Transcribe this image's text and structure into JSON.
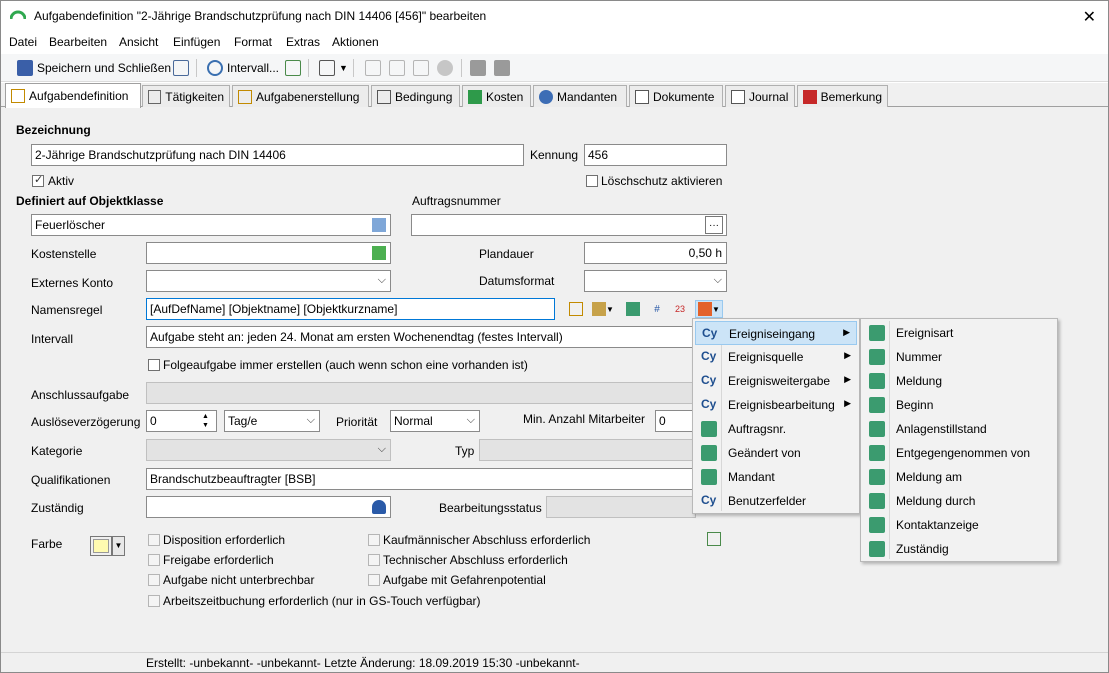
{
  "window": {
    "title": "Aufgabendefinition \"2-Jährige Brandschutzprüfung nach DIN 14406 [456]\" bearbeiten"
  },
  "menubar": {
    "items": [
      "Datei",
      "Bearbeiten",
      "Ansicht",
      "Einfügen",
      "Format",
      "Extras",
      "Aktionen"
    ]
  },
  "toolbar": {
    "save_close": "Speichern und Schließen",
    "interval": "Intervall..."
  },
  "tabs": [
    {
      "label": "Aufgabendefinition",
      "icon": "task-check-icon",
      "active": true
    },
    {
      "label": "Tätigkeiten",
      "icon": "wrench-icon",
      "active": false
    },
    {
      "label": "Aufgabenerstellung",
      "icon": "task-create-icon",
      "active": false
    },
    {
      "label": "Bedingung",
      "icon": "condition-icon",
      "active": false
    },
    {
      "label": "Kosten",
      "icon": "money-icon",
      "active": false
    },
    {
      "label": "Mandanten",
      "icon": "people-icon",
      "active": false
    },
    {
      "label": "Dokumente",
      "icon": "document-icon",
      "active": false
    },
    {
      "label": "Journal",
      "icon": "journal-icon",
      "active": false
    },
    {
      "label": "Bemerkung",
      "icon": "note-icon",
      "active": false
    }
  ],
  "form": {
    "bezeichnung_label": "Bezeichnung",
    "bezeichnung_value": "2-Jährige Brandschutzprüfung nach DIN 14406",
    "kennung_label": "Kennung",
    "kennung_value": "456",
    "aktiv_label": "Aktiv",
    "aktiv_checked": true,
    "loeschschutz_label": "Löschschutz aktivieren",
    "objektklasse_label": "Definiert auf Objektklasse",
    "objektklasse_value": "Feuerlöscher",
    "auftragsnummer_label": "Auftragsnummer",
    "auftragsnummer_value": "",
    "auftragsnummer_button": "···",
    "kostenstelle_label": "Kostenstelle",
    "plandauer_label": "Plandauer",
    "plandauer_value": "0,50 h",
    "externes_konto_label": "Externes Konto",
    "datumsformat_label": "Datumsformat",
    "namensregel_label": "Namensregel",
    "namensregel_value": "[AufDefName] [Objektname] [Objektkurzname]",
    "intervall_label": "Intervall",
    "intervall_value": "Aufgabe steht an: jeden 24. Monat am ersten Wochenendtag  (festes Intervall)",
    "folgeaufgabe_label": "Folgeaufgabe immer erstellen (auch wenn schon eine vorhanden ist)",
    "anschluss_label": "Anschlussaufgabe",
    "ausloese_label": "Auslöseverzögerung",
    "ausloese_value": "0",
    "ausloese_unit": "Tag/e",
    "prioritaet_label": "Priorität",
    "prioritaet_value": "Normal",
    "mitarbeiter_label": "Min. Anzahl Mitarbeiter",
    "mitarbeiter_value": "0",
    "kategorie_label": "Kategorie",
    "typ_label": "Typ",
    "qualifikationen_label": "Qualifikationen",
    "qualifikationen_value": "Brandschutzbeauftragter [BSB]",
    "zustaendig_label": "Zuständig",
    "bearbeitungsstatus_label": "Bearbeitungsstatus",
    "farbe_label": "Farbe",
    "farbe_color": "#fffbb0",
    "checkboxes_left": [
      "Disposition erforderlich",
      "Freigabe erforderlich",
      "Aufgabe nicht unterbrechbar",
      "Arbeitszeitbuchung erforderlich (nur in GS-Touch verfügbar)"
    ],
    "checkboxes_right": [
      "Kaufmännischer Abschluss erforderlich",
      "Technischer Abschluss erforderlich",
      "Aufgabe mit Gefahrenpotential"
    ]
  },
  "context_menu": {
    "items": [
      {
        "label": "Ereigniseingang",
        "icon": "cy-icon",
        "submenu": true,
        "highlighted": true
      },
      {
        "label": "Ereignisquelle",
        "icon": "cy-icon",
        "submenu": true,
        "highlighted": false
      },
      {
        "label": "Ereignisweitergabe",
        "icon": "cy-icon",
        "submenu": true,
        "highlighted": false
      },
      {
        "label": "Ereignisbearbeitung",
        "icon": "cy-icon",
        "submenu": true,
        "highlighted": false
      },
      {
        "label": "Auftragsnr.",
        "icon": "flow-icon",
        "submenu": false,
        "highlighted": false
      },
      {
        "label": "Geändert von",
        "icon": "flow-icon",
        "submenu": false,
        "highlighted": false
      },
      {
        "label": "Mandant",
        "icon": "flow-icon",
        "submenu": false,
        "highlighted": false
      },
      {
        "label": "Benutzerfelder",
        "icon": "cy-icon",
        "submenu": false,
        "highlighted": false
      }
    ]
  },
  "submenu": {
    "items": [
      "Ereignisart",
      "Nummer",
      "Meldung",
      "Beginn",
      "Anlagenstillstand",
      "Entgegengenommen von",
      "Meldung am",
      "Meldung durch",
      "Kontaktanzeige",
      "Zuständig"
    ]
  },
  "status": {
    "text": "Erstellt: -unbekannt- -unbekannt-  Letzte Änderung: 18.09.2019 15:30 -unbekannt-"
  }
}
